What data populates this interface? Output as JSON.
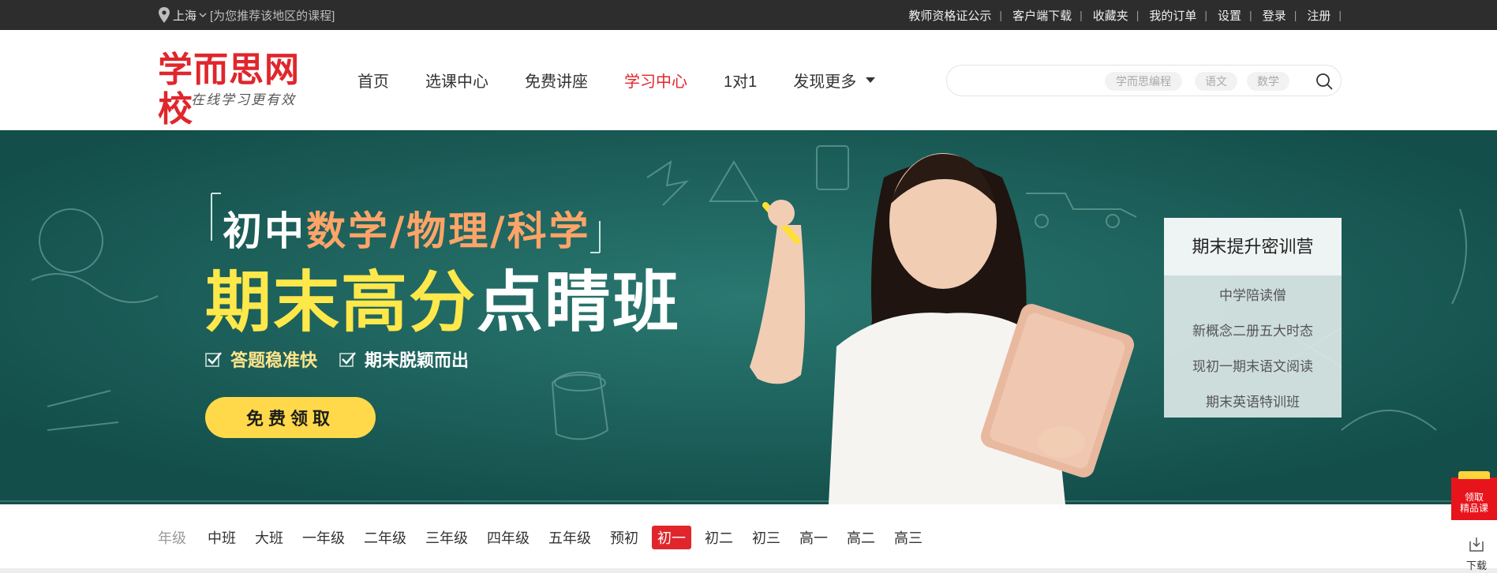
{
  "topbar": {
    "location": "上海",
    "location_hint": "[为您推荐该地区的课程]",
    "links": [
      "教师资格证公示",
      "客户端下载",
      "收藏夹",
      "我的订单",
      "设置",
      "登录",
      "注册"
    ]
  },
  "logo": {
    "main": "学而思网校",
    "slogan": "在线学习更有效"
  },
  "nav": {
    "items": [
      "首页",
      "选课中心",
      "免费讲座",
      "学习中心",
      "1对1",
      "发现更多"
    ],
    "active_index": 3
  },
  "search": {
    "placeholder": "",
    "tags": [
      "学而思编程",
      "语文",
      "数学"
    ]
  },
  "banner": {
    "subtitle_prefix": "初中",
    "subtitle_highlight": "数学/物理/科学",
    "title_yellow": "期末高分",
    "title_white": "点睛班",
    "features": [
      "答题稳准快",
      "期末脱颖而出"
    ],
    "cta": "免费领取"
  },
  "side_panel": {
    "title": "期末提升密训营",
    "items": [
      "中学陪读僧",
      "新概念二册五大时态",
      "现初一期末语文阅读",
      "期末英语特训班"
    ]
  },
  "grades": {
    "label": "年级",
    "items": [
      "中班",
      "大班",
      "一年级",
      "二年级",
      "三年级",
      "四年级",
      "五年级",
      "预初",
      "初一",
      "初二",
      "初三",
      "高一",
      "高二",
      "高三"
    ],
    "active": "初一"
  },
  "widgets": {
    "promo": "领取精品课",
    "download": "下载"
  },
  "colors": {
    "brand": "#e0262c",
    "banner_bg": "#1a5f5a",
    "cta": "#ffd94a"
  }
}
